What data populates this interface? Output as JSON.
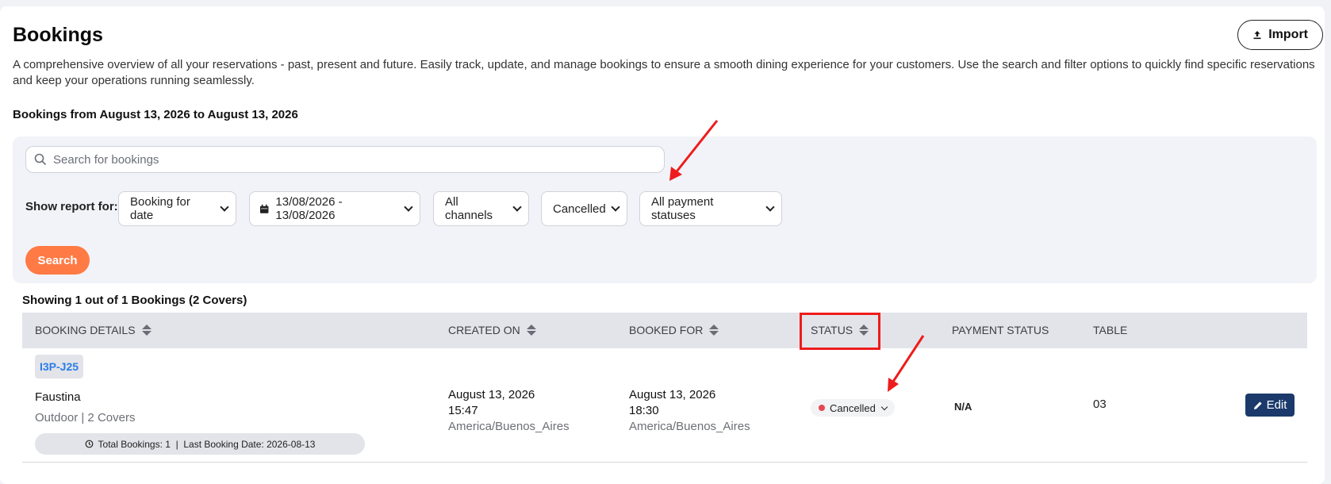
{
  "header": {
    "title": "Bookings",
    "import_label": "Import",
    "description": "A comprehensive overview of all your reservations - past, present and future. Easily track, update, and manage bookings to ensure a smooth dining experience for your customers. Use the search and filter options to quickly find specific reservations and keep your operations running seamlessly.",
    "range_text": "Bookings from August 13, 2026 to August 13, 2026"
  },
  "filters": {
    "search_placeholder": "Search for bookings",
    "show_report_label": "Show report for:",
    "date_type": "Booking for date",
    "date_range": "13/08/2026 - 13/08/2026",
    "channel": "All channels",
    "status": "Cancelled",
    "payment_status": "All payment statuses",
    "search_label": "Search"
  },
  "results": {
    "summary": "Showing 1 out of 1 Bookings (2 Covers)"
  },
  "table": {
    "headers": {
      "booking_details": "BOOKING DETAILS",
      "created_on": "CREATED ON",
      "booked_for": "BOOKED FOR",
      "status": "STATUS",
      "payment_status": "PAYMENT STATUS",
      "table": "TABLE"
    },
    "rows": [
      {
        "code": "I3P-J25",
        "name": "Faustina",
        "meta": "Outdoor | 2 Covers",
        "history": "Total Bookings: 1  |  Last Booking Date: 2026-08-13",
        "created_date": "August 13, 2026",
        "created_time": "15:47",
        "created_tz": "America/Buenos_Aires",
        "booked_date": "August 13, 2026",
        "booked_time": "18:30",
        "booked_tz": "America/Buenos_Aires",
        "status": "Cancelled",
        "payment_status": "N/A",
        "table_no": "03",
        "edit_label": "Edit"
      }
    ]
  },
  "colors": {
    "accent": "#ff7a45",
    "edit_button": "#1b3a6b",
    "link": "#2b7de9",
    "annotation": "#ee1c1c",
    "cancelled_dot": "#e5484d"
  }
}
